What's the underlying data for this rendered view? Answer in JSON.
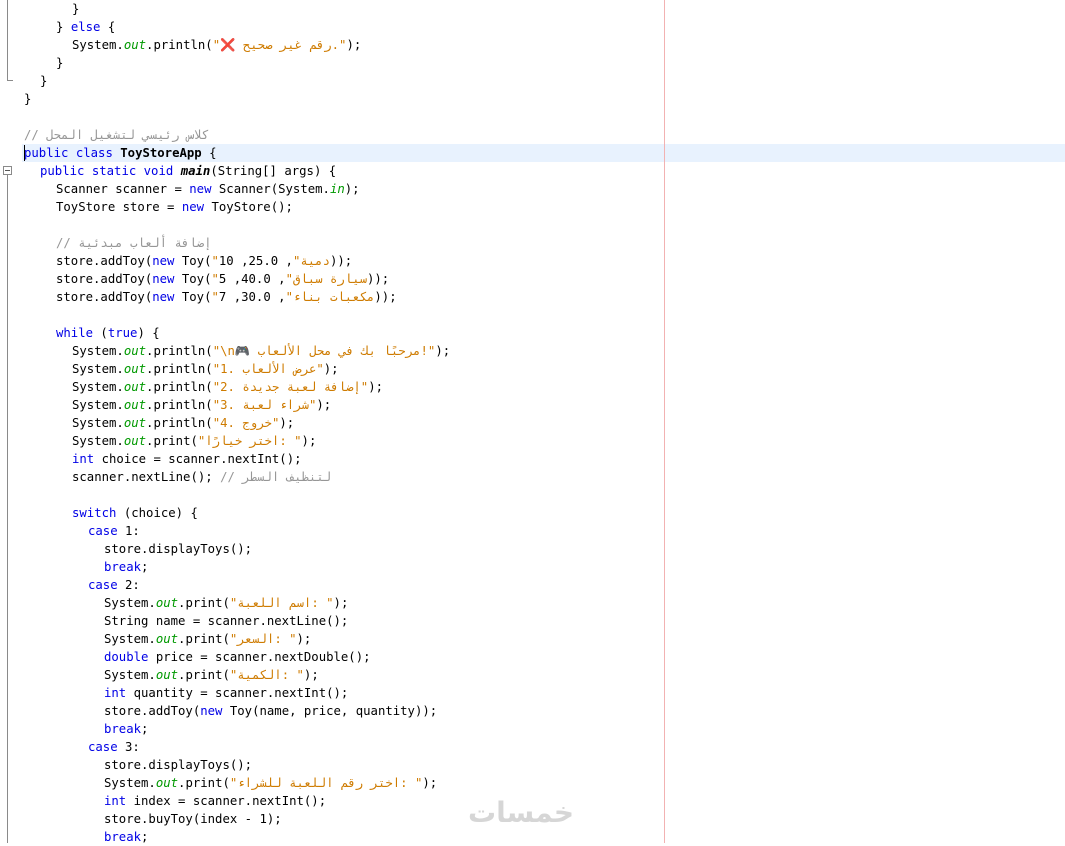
{
  "editor": {
    "lines": [
      {
        "indent": 6,
        "tokens": [
          {
            "t": "}",
            "s": "p"
          }
        ]
      },
      {
        "indent": 4,
        "tokens": [
          {
            "t": "} ",
            "s": "p"
          },
          {
            "t": "else",
            "s": "kw"
          },
          {
            "t": " {",
            "s": "p"
          }
        ]
      },
      {
        "indent": 6,
        "tokens": [
          {
            "t": "System.",
            "s": "p"
          },
          {
            "t": "out",
            "s": "fld"
          },
          {
            "t": ".println(",
            "s": "p"
          },
          {
            "t": "\"❌ رقم غير صحيح.\"",
            "s": "str"
          },
          {
            "t": ");",
            "s": "p"
          }
        ]
      },
      {
        "indent": 4,
        "tokens": [
          {
            "t": "}",
            "s": "p"
          }
        ]
      },
      {
        "indent": 2,
        "tokens": [
          {
            "t": "}",
            "s": "p"
          }
        ]
      },
      {
        "indent": 0,
        "tokens": [
          {
            "t": "}",
            "s": "p"
          }
        ]
      },
      {
        "indent": 0,
        "tokens": []
      },
      {
        "indent": 0,
        "tokens": [
          {
            "t": "// كلاس رئيسي لتشغيل المحل",
            "s": "cm"
          }
        ]
      },
      {
        "indent": 0,
        "tokens": [
          {
            "t": "public",
            "s": "kw"
          },
          {
            "t": " ",
            "s": "p"
          },
          {
            "t": "class",
            "s": "kw"
          },
          {
            "t": " ",
            "s": "p"
          },
          {
            "t": "ToyStoreApp",
            "s": "b"
          },
          {
            "t": " {",
            "s": "p"
          }
        ]
      },
      {
        "indent": 2,
        "tokens": [
          {
            "t": "public",
            "s": "kw"
          },
          {
            "t": " ",
            "s": "p"
          },
          {
            "t": "static",
            "s": "kw"
          },
          {
            "t": " ",
            "s": "p"
          },
          {
            "t": "void",
            "s": "kw"
          },
          {
            "t": " ",
            "s": "p"
          },
          {
            "t": "main",
            "s": "bi"
          },
          {
            "t": "(String[] args) {",
            "s": "p"
          }
        ]
      },
      {
        "indent": 4,
        "tokens": [
          {
            "t": "Scanner scanner = ",
            "s": "p"
          },
          {
            "t": "new",
            "s": "kw"
          },
          {
            "t": " Scanner(System.",
            "s": "p"
          },
          {
            "t": "in",
            "s": "fld"
          },
          {
            "t": ");",
            "s": "p"
          }
        ]
      },
      {
        "indent": 4,
        "tokens": [
          {
            "t": "ToyStore store = ",
            "s": "p"
          },
          {
            "t": "new",
            "s": "kw"
          },
          {
            "t": " ToyStore();",
            "s": "p"
          }
        ]
      },
      {
        "indent": 0,
        "tokens": []
      },
      {
        "indent": 4,
        "tokens": [
          {
            "t": "// إضافة ألعاب مبدئية",
            "s": "cm"
          }
        ]
      },
      {
        "indent": 4,
        "tokens": [
          {
            "t": "store.addToy(",
            "s": "p"
          },
          {
            "t": "new",
            "s": "kw"
          },
          {
            "t": " Toy(",
            "s": "p"
          },
          {
            "t": "\"دمية\"",
            "s": "str"
          },
          {
            "t": ", 25.0, 10));",
            "s": "p"
          }
        ]
      },
      {
        "indent": 4,
        "tokens": [
          {
            "t": "store.addToy(",
            "s": "p"
          },
          {
            "t": "new",
            "s": "kw"
          },
          {
            "t": " Toy(",
            "s": "p"
          },
          {
            "t": "\"سيارة سباق\"",
            "s": "str"
          },
          {
            "t": ", 40.0, 5));",
            "s": "p"
          }
        ]
      },
      {
        "indent": 4,
        "tokens": [
          {
            "t": "store.addToy(",
            "s": "p"
          },
          {
            "t": "new",
            "s": "kw"
          },
          {
            "t": " Toy(",
            "s": "p"
          },
          {
            "t": "\"مكعبات بناء\"",
            "s": "str"
          },
          {
            "t": ", 30.0, 7));",
            "s": "p"
          }
        ]
      },
      {
        "indent": 0,
        "tokens": []
      },
      {
        "indent": 4,
        "tokens": [
          {
            "t": "while",
            "s": "kw"
          },
          {
            "t": " (",
            "s": "p"
          },
          {
            "t": "true",
            "s": "kw"
          },
          {
            "t": ") {",
            "s": "p"
          }
        ]
      },
      {
        "indent": 6,
        "tokens": [
          {
            "t": "System.",
            "s": "p"
          },
          {
            "t": "out",
            "s": "fld"
          },
          {
            "t": ".println(",
            "s": "p"
          },
          {
            "t": "\"\\n🎮 مرحبًا بك في محل الألعاب!\"",
            "s": "str"
          },
          {
            "t": ");",
            "s": "p"
          }
        ]
      },
      {
        "indent": 6,
        "tokens": [
          {
            "t": "System.",
            "s": "p"
          },
          {
            "t": "out",
            "s": "fld"
          },
          {
            "t": ".println(",
            "s": "p"
          },
          {
            "t": "\"1. عرض الألعاب\"",
            "s": "str"
          },
          {
            "t": ");",
            "s": "p"
          }
        ]
      },
      {
        "indent": 6,
        "tokens": [
          {
            "t": "System.",
            "s": "p"
          },
          {
            "t": "out",
            "s": "fld"
          },
          {
            "t": ".println(",
            "s": "p"
          },
          {
            "t": "\"2. إضافة لعبة جديدة\"",
            "s": "str"
          },
          {
            "t": ");",
            "s": "p"
          }
        ]
      },
      {
        "indent": 6,
        "tokens": [
          {
            "t": "System.",
            "s": "p"
          },
          {
            "t": "out",
            "s": "fld"
          },
          {
            "t": ".println(",
            "s": "p"
          },
          {
            "t": "\"3. شراء لعبة\"",
            "s": "str"
          },
          {
            "t": ");",
            "s": "p"
          }
        ]
      },
      {
        "indent": 6,
        "tokens": [
          {
            "t": "System.",
            "s": "p"
          },
          {
            "t": "out",
            "s": "fld"
          },
          {
            "t": ".println(",
            "s": "p"
          },
          {
            "t": "\"4. خروج\"",
            "s": "str"
          },
          {
            "t": ");",
            "s": "p"
          }
        ]
      },
      {
        "indent": 6,
        "tokens": [
          {
            "t": "System.",
            "s": "p"
          },
          {
            "t": "out",
            "s": "fld"
          },
          {
            "t": ".print(",
            "s": "p"
          },
          {
            "t": "\"اختر خيارًا: \"",
            "s": "str"
          },
          {
            "t": ");",
            "s": "p"
          }
        ]
      },
      {
        "indent": 6,
        "tokens": [
          {
            "t": "int",
            "s": "kw"
          },
          {
            "t": " choice = scanner.nextInt();",
            "s": "p"
          }
        ]
      },
      {
        "indent": 6,
        "tokens": [
          {
            "t": "scanner.nextLine(); ",
            "s": "p"
          },
          {
            "t": "// لتنظيف السطر",
            "s": "cm"
          }
        ]
      },
      {
        "indent": 0,
        "tokens": []
      },
      {
        "indent": 6,
        "tokens": [
          {
            "t": "switch",
            "s": "kw"
          },
          {
            "t": " (choice) {",
            "s": "p"
          }
        ]
      },
      {
        "indent": 8,
        "tokens": [
          {
            "t": "case",
            "s": "kw"
          },
          {
            "t": " 1:",
            "s": "p"
          }
        ]
      },
      {
        "indent": 10,
        "tokens": [
          {
            "t": "store.displayToys();",
            "s": "p"
          }
        ]
      },
      {
        "indent": 10,
        "tokens": [
          {
            "t": "break",
            "s": "kw"
          },
          {
            "t": ";",
            "s": "p"
          }
        ]
      },
      {
        "indent": 8,
        "tokens": [
          {
            "t": "case",
            "s": "kw"
          },
          {
            "t": " 2:",
            "s": "p"
          }
        ]
      },
      {
        "indent": 10,
        "tokens": [
          {
            "t": "System.",
            "s": "p"
          },
          {
            "t": "out",
            "s": "fld"
          },
          {
            "t": ".print(",
            "s": "p"
          },
          {
            "t": "\"اسم اللعبة: \"",
            "s": "str"
          },
          {
            "t": ");",
            "s": "p"
          }
        ]
      },
      {
        "indent": 10,
        "tokens": [
          {
            "t": "String name = scanner.nextLine();",
            "s": "p"
          }
        ]
      },
      {
        "indent": 10,
        "tokens": [
          {
            "t": "System.",
            "s": "p"
          },
          {
            "t": "out",
            "s": "fld"
          },
          {
            "t": ".print(",
            "s": "p"
          },
          {
            "t": "\"السعر: \"",
            "s": "str"
          },
          {
            "t": ");",
            "s": "p"
          }
        ]
      },
      {
        "indent": 10,
        "tokens": [
          {
            "t": "double",
            "s": "kw"
          },
          {
            "t": " price = scanner.nextDouble();",
            "s": "p"
          }
        ]
      },
      {
        "indent": 10,
        "tokens": [
          {
            "t": "System.",
            "s": "p"
          },
          {
            "t": "out",
            "s": "fld"
          },
          {
            "t": ".print(",
            "s": "p"
          },
          {
            "t": "\"الكمية: \"",
            "s": "str"
          },
          {
            "t": ");",
            "s": "p"
          }
        ]
      },
      {
        "indent": 10,
        "tokens": [
          {
            "t": "int",
            "s": "kw"
          },
          {
            "t": " quantity = scanner.nextInt();",
            "s": "p"
          }
        ]
      },
      {
        "indent": 10,
        "tokens": [
          {
            "t": "store.addToy(",
            "s": "p"
          },
          {
            "t": "new",
            "s": "kw"
          },
          {
            "t": " Toy(name, price, quantity));",
            "s": "p"
          }
        ]
      },
      {
        "indent": 10,
        "tokens": [
          {
            "t": "break",
            "s": "kw"
          },
          {
            "t": ";",
            "s": "p"
          }
        ]
      },
      {
        "indent": 8,
        "tokens": [
          {
            "t": "case",
            "s": "kw"
          },
          {
            "t": " 3:",
            "s": "p"
          }
        ]
      },
      {
        "indent": 10,
        "tokens": [
          {
            "t": "store.displayToys();",
            "s": "p"
          }
        ]
      },
      {
        "indent": 10,
        "tokens": [
          {
            "t": "System.",
            "s": "p"
          },
          {
            "t": "out",
            "s": "fld"
          },
          {
            "t": ".print(",
            "s": "p"
          },
          {
            "t": "\"اختر رقم اللعبة للشراء: \"",
            "s": "str"
          },
          {
            "t": ");",
            "s": "p"
          }
        ]
      },
      {
        "indent": 10,
        "tokens": [
          {
            "t": "int",
            "s": "kw"
          },
          {
            "t": " index = scanner.nextInt();",
            "s": "p"
          }
        ]
      },
      {
        "indent": 10,
        "tokens": [
          {
            "t": "store.buyToy(index - 1);",
            "s": "p"
          }
        ]
      },
      {
        "indent": 10,
        "tokens": [
          {
            "t": "break",
            "s": "kw"
          },
          {
            "t": ";",
            "s": "p"
          }
        ]
      }
    ],
    "colors": {
      "keyword": "#0000e6",
      "string": "#ce7b00",
      "comment": "#969696",
      "field": "#009900",
      "current_line": "#e8f2fe",
      "margin_line": "#f2b2b2"
    }
  },
  "watermark": {
    "text": "خمسات"
  }
}
